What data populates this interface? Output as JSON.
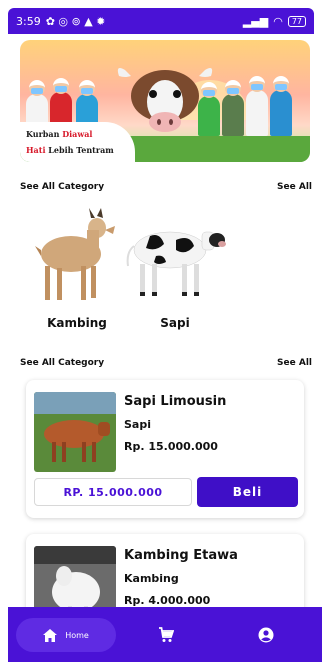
{
  "status_bar": {
    "time": "3:59",
    "battery": "77"
  },
  "banner": {
    "line1_a": "Kurban ",
    "line1_b": "Diawal",
    "line2_a": "Hati",
    "line2_b": " Lebih Tentram"
  },
  "sections": [
    {
      "title": "See All Category",
      "action": "See All"
    },
    {
      "title": "See All Category",
      "action": "See All"
    }
  ],
  "categories": [
    {
      "label": "Kambing"
    },
    {
      "label": "Sapi"
    }
  ],
  "products": [
    {
      "name": "Sapi Limousin",
      "category": "Sapi",
      "price": "Rp. 15.000.000",
      "price_box": "RP. 15.000.000",
      "buy_label": "Beli"
    },
    {
      "name": "Kambing Etawa",
      "category": "Kambing",
      "price": "Rp. 4.000.000"
    }
  ],
  "nav": {
    "home_label": "Home"
  },
  "colors": {
    "primary": "#4a12d6",
    "button": "#3f0fc7",
    "accent_red": "#d7192a"
  }
}
